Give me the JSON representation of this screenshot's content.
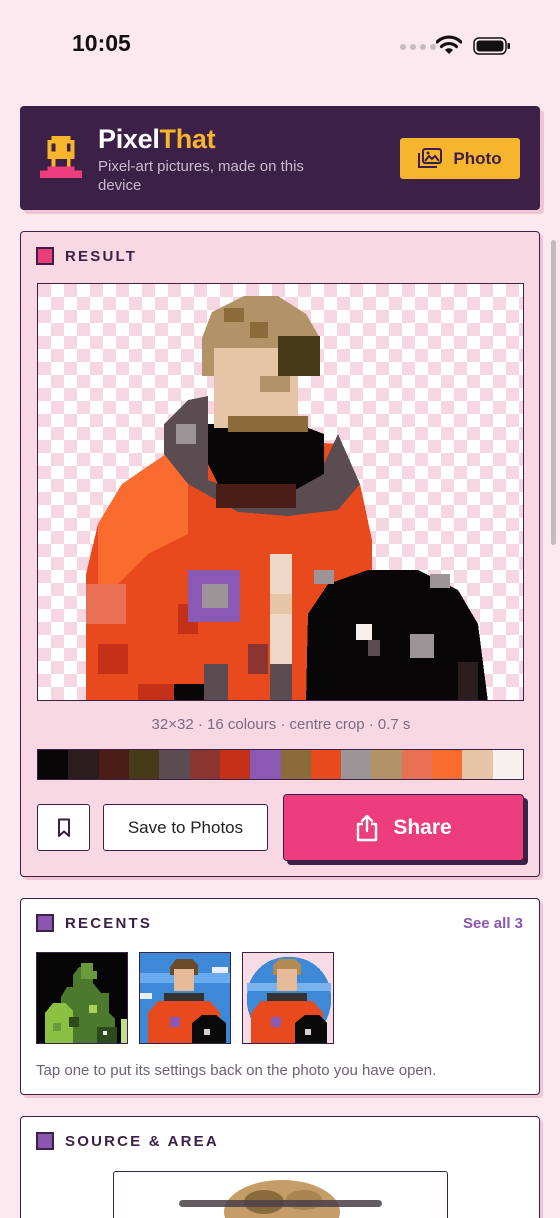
{
  "status_bar": {
    "time": "10:05"
  },
  "header": {
    "title_part1": "Pixel",
    "title_part2": "That",
    "subtitle": "Pixel-art pictures, made on this device",
    "photo_button_label": "Photo"
  },
  "result": {
    "section_title": "RESULT",
    "caption": "32×32 · 16 colours · centre crop · 0.7 s",
    "palette": [
      "#080606",
      "#2b1d1d",
      "#4a1d17",
      "#473a18",
      "#5a4c50",
      "#8b3430",
      "#c43118",
      "#8a59b4",
      "#8a6b39",
      "#e84a1d",
      "#9c9496",
      "#b29368",
      "#e87055",
      "#f96b2f",
      "#e6c4a6",
      "#f8f0ec"
    ],
    "save_label": "Save to Photos",
    "share_label": "Share"
  },
  "recents": {
    "section_title": "RECENTS",
    "see_all_label": "See all 3",
    "hint": "Tap one to put its settings back on the photo you have open."
  },
  "source": {
    "section_title": "SOURCE & AREA"
  },
  "colors": {
    "brand_dark": "#3d2047",
    "accent_pink": "#ee3d7d",
    "accent_yellow": "#f7b52d",
    "accent_purple": "#8a56b0",
    "background": "#fce8ef"
  },
  "icons": [
    "wifi-icon",
    "battery-icon",
    "pixel-robot-logo-icon",
    "photo-icon",
    "bookmark-icon",
    "share-icon"
  ]
}
